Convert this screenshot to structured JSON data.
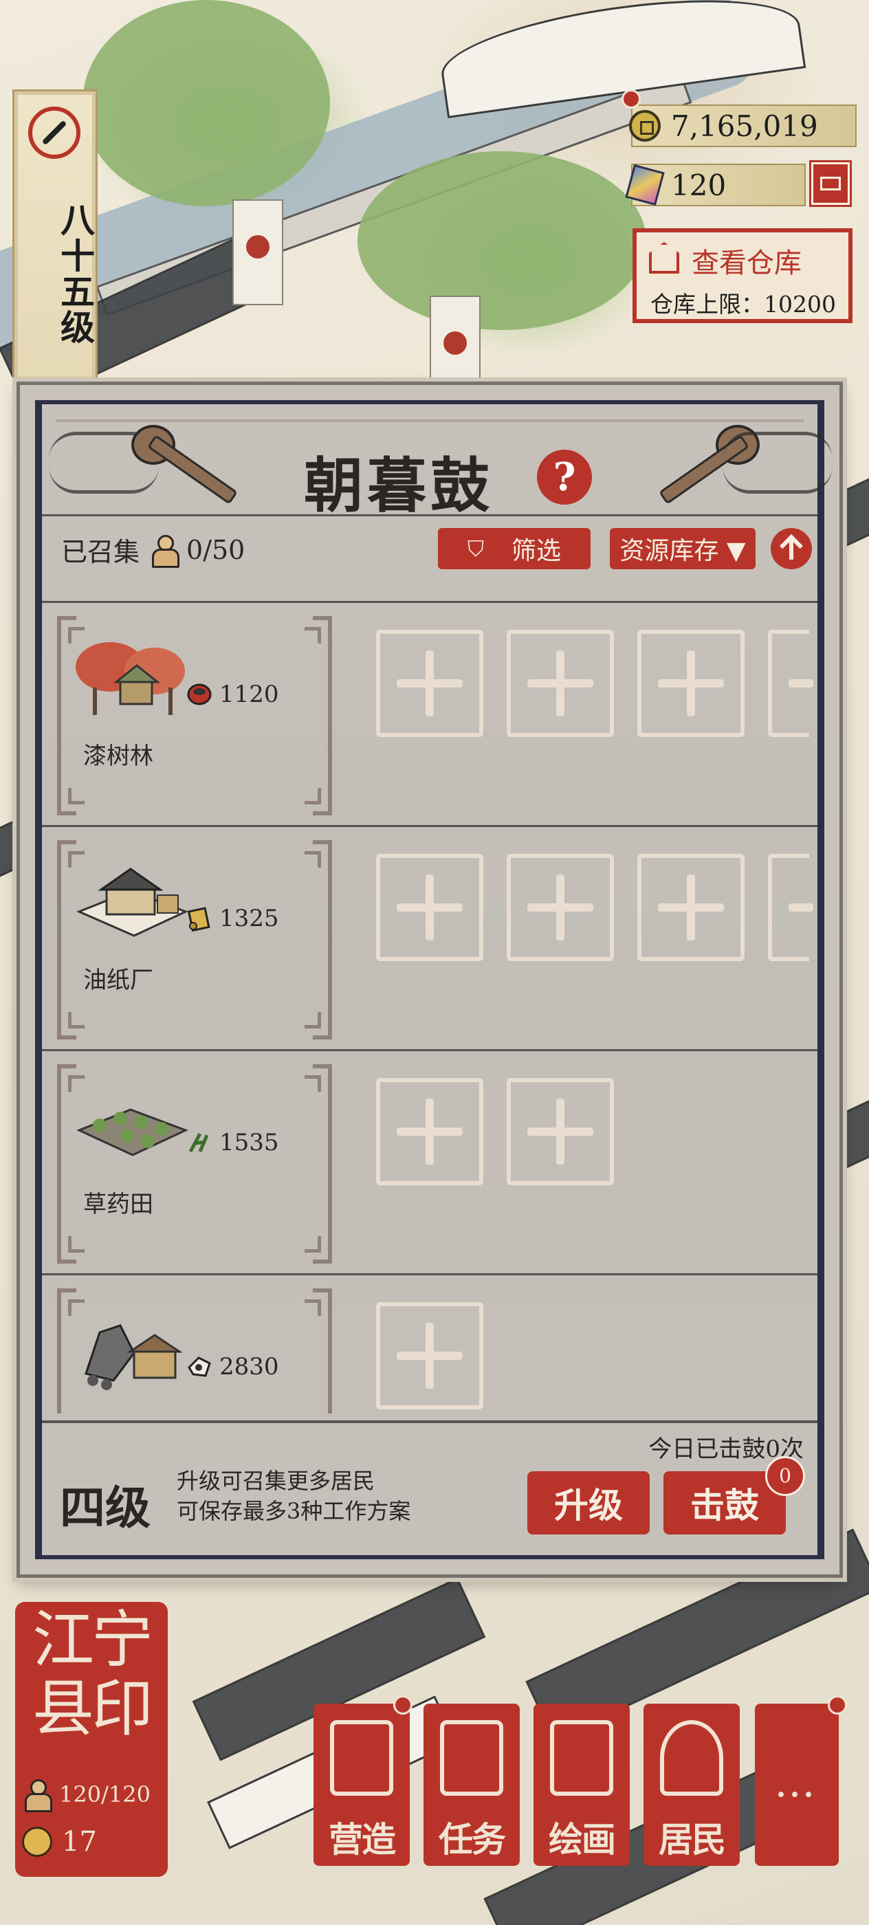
{
  "hud": {
    "level_text": "八十五级",
    "coins": "7,165,019",
    "gems": "120",
    "warehouse": {
      "title": "查看仓库",
      "limit": "仓库上限：10200"
    }
  },
  "panel": {
    "title": "朝暮鼓",
    "help": "?",
    "summoned_label": "已召集",
    "summoned_count": "0/50",
    "filter_label": "筛选",
    "sort_label": "资源库存 ▼",
    "rows": [
      {
        "name": "漆树林",
        "resource_icon": "lacquer-bowl-icon",
        "value": "1120",
        "slots": 4
      },
      {
        "name": "油纸厂",
        "resource_icon": "paper-scroll-icon",
        "value": "1325",
        "slots": 4
      },
      {
        "name": "草药田",
        "resource_icon": "herb-icon",
        "value": "1535",
        "slots": 2
      },
      {
        "name": "",
        "resource_icon": "ore-icon",
        "value": "2830",
        "slots": 1
      }
    ],
    "grade": "四级",
    "grade_desc_1": "升级可召集更多居民",
    "grade_desc_2": "可保存最多3种工作方案",
    "today_status": "今日已击鼓0次",
    "upgrade_label": "升级",
    "drum_label": "击鼓",
    "drum_badge": "0"
  },
  "bottom": {
    "seal_text": "江宁县印",
    "residents": "120/120",
    "gold_count": "17",
    "menu": [
      {
        "label": "营造",
        "icon": "building-icon"
      },
      {
        "label": "任务",
        "icon": "task-book-icon"
      },
      {
        "label": "绘画",
        "icon": "painting-scroll-icon"
      },
      {
        "label": "居民",
        "icon": "resident-icon"
      }
    ],
    "more": "…"
  },
  "colors": {
    "accent_red": "#b8342a",
    "panel_bg": "#c7c1bb",
    "frame_navy": "#2c2f45"
  }
}
